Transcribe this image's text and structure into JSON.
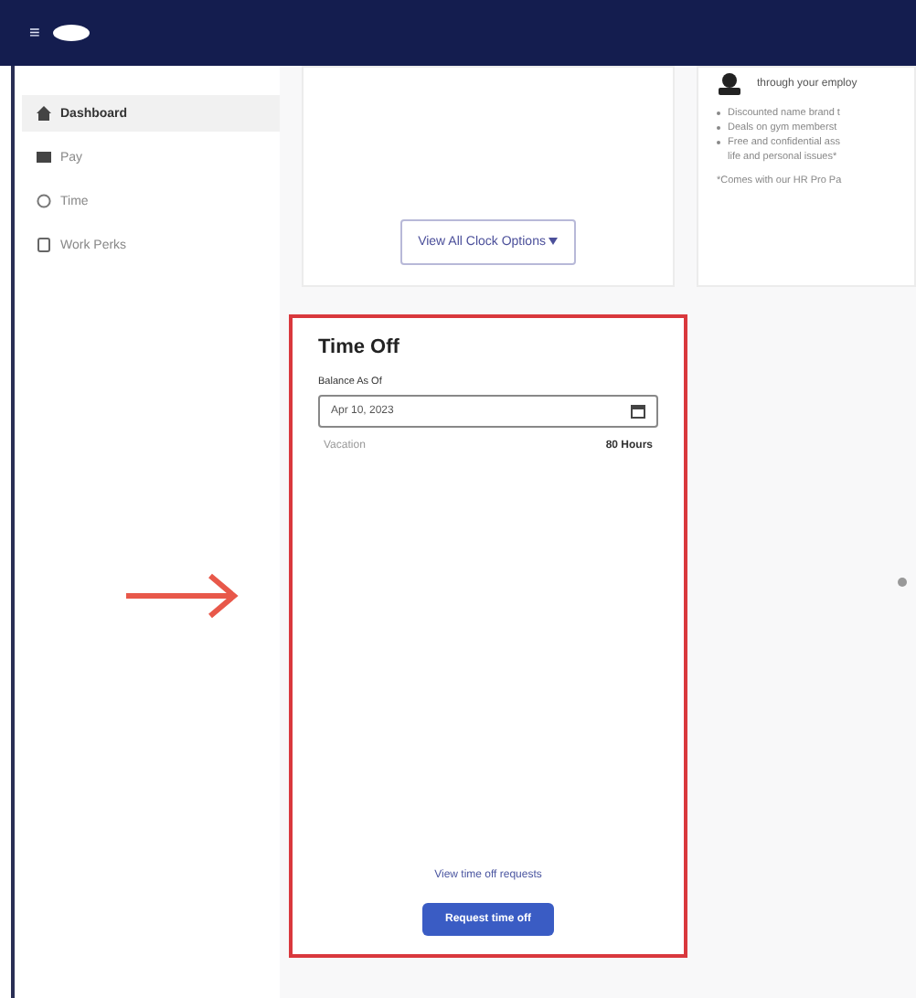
{
  "header": {
    "menu_glyph": "≡"
  },
  "sidebar": {
    "items": [
      {
        "label": "Dashboard",
        "selected": true
      },
      {
        "label": "Pay",
        "selected": false
      },
      {
        "label": "Time",
        "selected": false
      },
      {
        "label": "Work Perks",
        "selected": false
      }
    ]
  },
  "clock_card": {
    "button": "View All Clock Options"
  },
  "perks_card": {
    "heading": "through your employ",
    "bullets": [
      "Discounted name brand t",
      "Deals on gym memberst",
      "Free and confidential ass"
    ],
    "continuation": "life and personal issues*",
    "footnote": "*Comes with our HR Pro Pa"
  },
  "time_off": {
    "title": "Time Off",
    "balance_label": "Balance As Of",
    "date": "Apr 10, 2023",
    "balances": [
      {
        "name": "Vacation",
        "amount": "80 Hours"
      }
    ],
    "link": "View time off requests",
    "button": "Request time off"
  }
}
